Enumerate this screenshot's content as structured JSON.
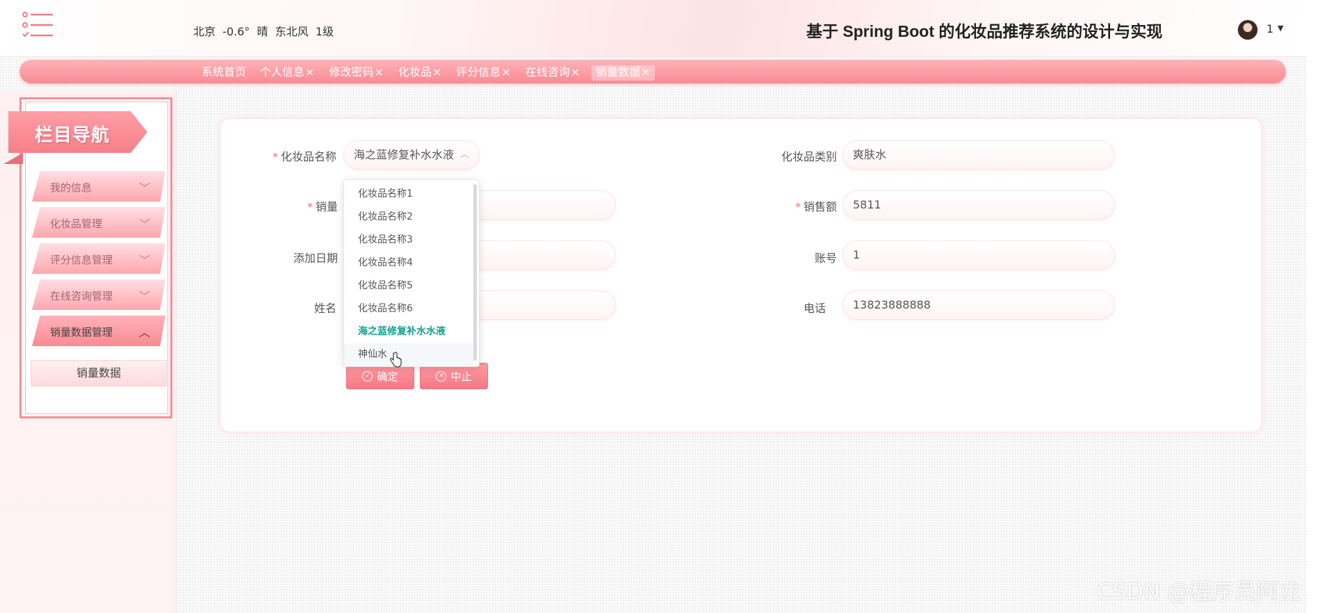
{
  "header": {
    "weather": "北京  -0.6°  晴  东北风  1级",
    "title": "基于 Spring Boot 的化妆品推荐系统的设计与实现",
    "user": "1"
  },
  "tabs": [
    {
      "label": "系统首页",
      "close": ""
    },
    {
      "label": "个人信息",
      "close": "×"
    },
    {
      "label": "修改密码",
      "close": "×"
    },
    {
      "label": "化妆品",
      "close": "×"
    },
    {
      "label": "评分信息",
      "close": "×"
    },
    {
      "label": "在线咨询",
      "close": "×"
    },
    {
      "label": "销量数据",
      "close": "×"
    }
  ],
  "sidebar": {
    "heading": "栏目导航",
    "items": [
      {
        "label": "我的信息"
      },
      {
        "label": "化妆品管理"
      },
      {
        "label": "评分信息管理"
      },
      {
        "label": "在线咨询管理"
      },
      {
        "label": "销量数据管理"
      }
    ],
    "subitem": "销量数据"
  },
  "form": {
    "name_label": "化妆品名称",
    "name_value": "海之蓝修复补水水液",
    "category_label": "化妆品类别",
    "category_value": "爽肤水",
    "sales_label": "销量",
    "amount_label": "销售额",
    "amount_value": "5811",
    "date_label": "添加日期",
    "account_label": "账号",
    "account_value": "1",
    "person_label": "姓名",
    "phone_label": "电话",
    "phone_value": "13823888888",
    "confirm_label": "确定",
    "cancel_label": "中止"
  },
  "dropdown": {
    "options": [
      "化妆品名称1",
      "化妆品名称2",
      "化妆品名称3",
      "化妆品名称4",
      "化妆品名称5",
      "化妆品名称6",
      "海之蓝修复补水水液",
      "神仙水"
    ],
    "selected": "海之蓝修复补水水液",
    "hovered": "神仙水"
  },
  "watermark": "CSDN @程序员阿龙",
  "colors": {
    "accent": "#f98a92",
    "selected_option": "#14a08f",
    "required": "#f56c6c"
  }
}
